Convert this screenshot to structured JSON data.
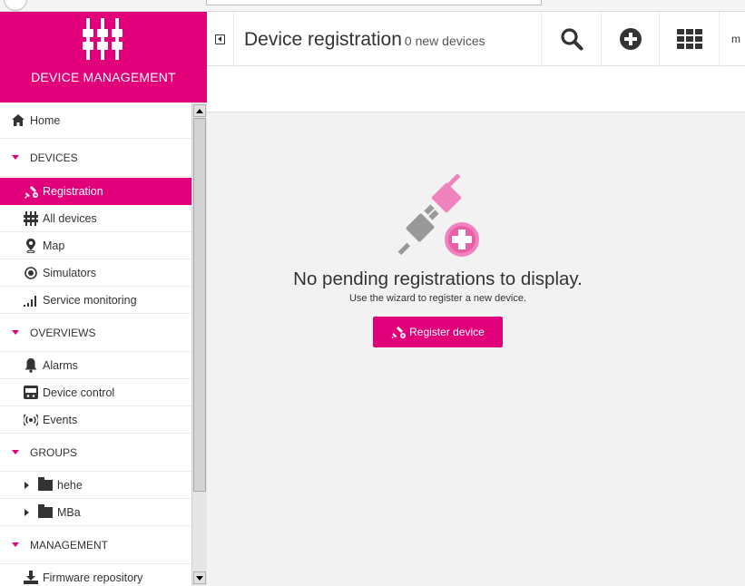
{
  "app": {
    "brand_title": "DEVICE MANAGEMENT",
    "accent_color": "#e2007a"
  },
  "header": {
    "title": "Device registration",
    "subtitle": "0 new devices",
    "user_initial": "m",
    "icons": [
      "collapse-sidebar-icon",
      "search-icon",
      "add-circle-icon",
      "app-grid-icon"
    ]
  },
  "sidebar": {
    "home": {
      "label": "Home",
      "icon": "home-icon"
    },
    "sections": {
      "devices": "DEVICES",
      "overviews": "OVERVIEWS",
      "groups": "GROUPS",
      "management": "MANAGEMENT"
    },
    "devices_items": [
      {
        "label": "Registration",
        "icon": "plug-icon",
        "active": true
      },
      {
        "label": "All devices",
        "icon": "devices-icon"
      },
      {
        "label": "Map",
        "icon": "map-pin-icon"
      },
      {
        "label": "Simulators",
        "icon": "simulator-icon"
      },
      {
        "label": "Service monitoring",
        "icon": "signal-bars-icon"
      }
    ],
    "overviews_items": [
      {
        "label": "Alarms",
        "icon": "bell-icon"
      },
      {
        "label": "Device control",
        "icon": "device-control-icon"
      },
      {
        "label": "Events",
        "icon": "broadcast-icon"
      }
    ],
    "groups_items": [
      {
        "label": "hehe",
        "icon": "folder-icon"
      },
      {
        "label": "MBa",
        "icon": "folder-icon"
      }
    ],
    "management_items": [
      {
        "label": "Firmware repository",
        "icon": "download-icon"
      }
    ]
  },
  "main": {
    "empty_title": "No pending registrations to display.",
    "empty_subtitle": "Use the wizard to register a new device.",
    "register_button": "Register device"
  }
}
